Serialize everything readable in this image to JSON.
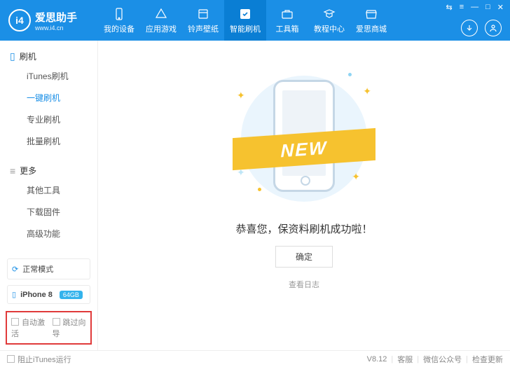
{
  "header": {
    "brand": "爱思助手",
    "url": "www.i4.cn",
    "logo_text": "i4",
    "nav": [
      {
        "label": "我的设备",
        "icon": "device"
      },
      {
        "label": "应用游戏",
        "icon": "apps"
      },
      {
        "label": "铃声壁纸",
        "icon": "ringtone"
      },
      {
        "label": "智能刷机",
        "icon": "flash",
        "active": true
      },
      {
        "label": "工具箱",
        "icon": "toolbox"
      },
      {
        "label": "教程中心",
        "icon": "tutorial"
      },
      {
        "label": "爱思商城",
        "icon": "store"
      }
    ],
    "sys": {
      "cart": "⇆",
      "menu": "≡",
      "min": "—",
      "max": "□",
      "close": "✕"
    }
  },
  "sidebar": {
    "section1": {
      "title": "刷机",
      "items": [
        "iTunes刷机",
        "一键刷机",
        "专业刷机",
        "批量刷机"
      ],
      "active_index": 1
    },
    "section2": {
      "title": "更多",
      "items": [
        "其他工具",
        "下载固件",
        "高级功能"
      ]
    },
    "mode": "正常模式",
    "device": {
      "name": "iPhone 8",
      "storage": "64GB"
    },
    "checkboxes": {
      "auto_activate": "自动激活",
      "skip_guide": "跳过向导"
    }
  },
  "main": {
    "ribbon": "NEW",
    "success_text": "恭喜您，保资料刷机成功啦！",
    "ok": "确定",
    "view_log": "查看日志"
  },
  "footer": {
    "block_itunes": "阻止iTunes运行",
    "version": "V8.12",
    "support": "客服",
    "wechat": "微信公众号",
    "update": "检查更新"
  }
}
